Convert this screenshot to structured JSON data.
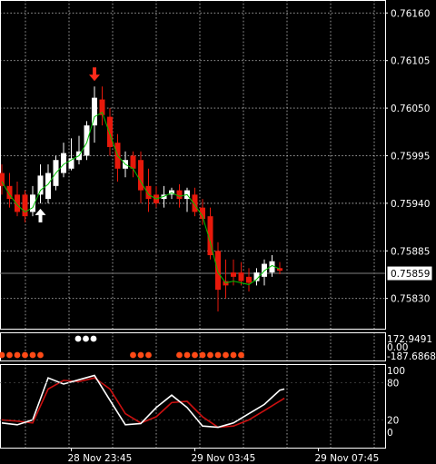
{
  "chart_data": {
    "type": "candlestick",
    "colors": {
      "background": "#000000",
      "grid": "#e6e6e6",
      "bull": "#ffffff",
      "bear": "#e8190b",
      "ma": "#00c000",
      "arrow_up": "#ffffff",
      "arrow_down": "#ff2a1a",
      "dots_white": "#ffffff",
      "dots_orange": "#ff4a16",
      "stoch_main": "#ffffff",
      "stoch_signal": "#cc1010",
      "current_price_line": "#808080"
    },
    "price_axis": {
      "ylim": [
        0.75795,
        0.76175
      ],
      "ticks": [
        "0.76160",
        "0.76105",
        "0.76050",
        "0.75995",
        "0.75940",
        "0.75885",
        "0.75830"
      ],
      "current_price": "0.75859"
    },
    "time_axis": {
      "labels": [
        "28 Nov 23:45",
        "29 Nov 03:45",
        "29 Nov 07:45"
      ],
      "label_bars": [
        9,
        25,
        41
      ]
    },
    "candles": [
      {
        "o": 0.75975,
        "h": 0.75985,
        "l": 0.7595,
        "c": 0.7596
      },
      {
        "o": 0.7596,
        "h": 0.75975,
        "l": 0.75935,
        "c": 0.75945
      },
      {
        "o": 0.7595,
        "h": 0.75965,
        "l": 0.75925,
        "c": 0.7593
      },
      {
        "o": 0.7595,
        "h": 0.75955,
        "l": 0.75918,
        "c": 0.75925
      },
      {
        "o": 0.7593,
        "h": 0.7596,
        "l": 0.75925,
        "c": 0.7595
      },
      {
        "o": 0.7595,
        "h": 0.75985,
        "l": 0.7594,
        "c": 0.75972
      },
      {
        "o": 0.75945,
        "h": 0.75985,
        "l": 0.7594,
        "c": 0.75975
      },
      {
        "o": 0.7596,
        "h": 0.75995,
        "l": 0.75955,
        "c": 0.7599
      },
      {
        "o": 0.75975,
        "h": 0.7601,
        "l": 0.7597,
        "c": 0.75998
      },
      {
        "o": 0.7598,
        "h": 0.76015,
        "l": 0.75978,
        "c": 0.75992
      },
      {
        "o": 0.7599,
        "h": 0.76018,
        "l": 0.75985,
        "c": 0.76
      },
      {
        "o": 0.75995,
        "h": 0.76035,
        "l": 0.7599,
        "c": 0.7603
      },
      {
        "o": 0.7603,
        "h": 0.76075,
        "l": 0.7601,
        "c": 0.76062
      },
      {
        "o": 0.7606,
        "h": 0.76075,
        "l": 0.7603,
        "c": 0.76042
      },
      {
        "o": 0.7604,
        "h": 0.7605,
        "l": 0.75995,
        "c": 0.76005
      },
      {
        "o": 0.7601,
        "h": 0.7602,
        "l": 0.75965,
        "c": 0.7598
      },
      {
        "o": 0.7598,
        "h": 0.76,
        "l": 0.7597,
        "c": 0.7599
      },
      {
        "o": 0.75995,
        "h": 0.76,
        "l": 0.7597,
        "c": 0.7598
      },
      {
        "o": 0.7599,
        "h": 0.76,
        "l": 0.7594,
        "c": 0.75955
      },
      {
        "o": 0.7596,
        "h": 0.7598,
        "l": 0.7593,
        "c": 0.75945
      },
      {
        "o": 0.7595,
        "h": 0.7596,
        "l": 0.75935,
        "c": 0.7594
      },
      {
        "o": 0.75945,
        "h": 0.7596,
        "l": 0.75935,
        "c": 0.7595
      },
      {
        "o": 0.7595,
        "h": 0.75958,
        "l": 0.75945,
        "c": 0.75955
      },
      {
        "o": 0.75955,
        "h": 0.75962,
        "l": 0.75935,
        "c": 0.75945
      },
      {
        "o": 0.75945,
        "h": 0.75958,
        "l": 0.7593,
        "c": 0.75955
      },
      {
        "o": 0.7595,
        "h": 0.75958,
        "l": 0.75925,
        "c": 0.7593
      },
      {
        "o": 0.75935,
        "h": 0.75945,
        "l": 0.75915,
        "c": 0.75922
      },
      {
        "o": 0.75925,
        "h": 0.75935,
        "l": 0.75875,
        "c": 0.7588
      },
      {
        "o": 0.75885,
        "h": 0.75895,
        "l": 0.75815,
        "c": 0.7584
      },
      {
        "o": 0.7585,
        "h": 0.75875,
        "l": 0.7583,
        "c": 0.75845
      },
      {
        "o": 0.7586,
        "h": 0.75875,
        "l": 0.75845,
        "c": 0.75855
      },
      {
        "o": 0.7586,
        "h": 0.75872,
        "l": 0.75845,
        "c": 0.7585
      },
      {
        "o": 0.75855,
        "h": 0.75865,
        "l": 0.75838,
        "c": 0.75848
      },
      {
        "o": 0.7585,
        "h": 0.75865,
        "l": 0.75845,
        "c": 0.7586
      },
      {
        "o": 0.75855,
        "h": 0.75875,
        "l": 0.75845,
        "c": 0.7587
      },
      {
        "o": 0.7586,
        "h": 0.7588,
        "l": 0.75855,
        "c": 0.75873
      },
      {
        "o": 0.75865,
        "h": 0.75872,
        "l": 0.75858,
        "c": 0.75862
      }
    ],
    "ma_line": [
      0.75965,
      0.7595,
      0.75938,
      0.7593,
      0.75935,
      0.75955,
      0.75962,
      0.75975,
      0.75985,
      0.7599,
      0.75995,
      0.7601,
      0.7604,
      0.76045,
      0.7602,
      0.75995,
      0.75985,
      0.7598,
      0.75965,
      0.7595,
      0.75945,
      0.75948,
      0.75952,
      0.75948,
      0.7595,
      0.75938,
      0.75925,
      0.75895,
      0.7586,
      0.75848,
      0.7585,
      0.75848,
      0.75846,
      0.75852,
      0.75862,
      0.75868,
      0.75864
    ],
    "signals": [
      {
        "type": "buy",
        "bar": 5
      },
      {
        "type": "sell",
        "bar": 12
      }
    ],
    "dots_panel": {
      "labels": [
        "172.9491",
        "0.00",
        "-187.6868"
      ],
      "white_bars": [
        10,
        11,
        12
      ],
      "orange_bars": [
        0,
        1,
        2,
        3,
        4,
        5,
        17,
        18,
        19,
        23,
        24,
        25,
        26,
        27,
        28,
        29,
        30,
        31
      ]
    },
    "stochastic": {
      "ylim": [
        0,
        100
      ],
      "ticks": [
        "100",
        "80",
        "20",
        "0"
      ],
      "tick_values": [
        100,
        80,
        20,
        0
      ],
      "main": [
        {
          "x": 0,
          "y": 15
        },
        {
          "x": 2,
          "y": 12
        },
        {
          "x": 4,
          "y": 20
        },
        {
          "x": 6,
          "y": 88
        },
        {
          "x": 8,
          "y": 78
        },
        {
          "x": 10,
          "y": 85
        },
        {
          "x": 12,
          "y": 92
        },
        {
          "x": 14,
          "y": 52
        },
        {
          "x": 16,
          "y": 12
        },
        {
          "x": 18,
          "y": 14
        },
        {
          "x": 20,
          "y": 40
        },
        {
          "x": 22,
          "y": 60
        },
        {
          "x": 24,
          "y": 40
        },
        {
          "x": 26,
          "y": 10
        },
        {
          "x": 28,
          "y": 8
        },
        {
          "x": 30,
          "y": 15
        },
        {
          "x": 32,
          "y": 30
        },
        {
          "x": 34,
          "y": 45
        },
        {
          "x": 36,
          "y": 68
        },
        {
          "x": 36.6,
          "y": 70
        }
      ],
      "signal": [
        {
          "x": 0,
          "y": 20
        },
        {
          "x": 2,
          "y": 18
        },
        {
          "x": 4,
          "y": 15
        },
        {
          "x": 6,
          "y": 70
        },
        {
          "x": 8,
          "y": 84
        },
        {
          "x": 10,
          "y": 82
        },
        {
          "x": 12,
          "y": 88
        },
        {
          "x": 14,
          "y": 70
        },
        {
          "x": 16,
          "y": 30
        },
        {
          "x": 18,
          "y": 15
        },
        {
          "x": 20,
          "y": 25
        },
        {
          "x": 22,
          "y": 48
        },
        {
          "x": 24,
          "y": 50
        },
        {
          "x": 26,
          "y": 25
        },
        {
          "x": 28,
          "y": 8
        },
        {
          "x": 30,
          "y": 10
        },
        {
          "x": 32,
          "y": 20
        },
        {
          "x": 34,
          "y": 35
        },
        {
          "x": 36.6,
          "y": 55
        }
      ]
    }
  }
}
